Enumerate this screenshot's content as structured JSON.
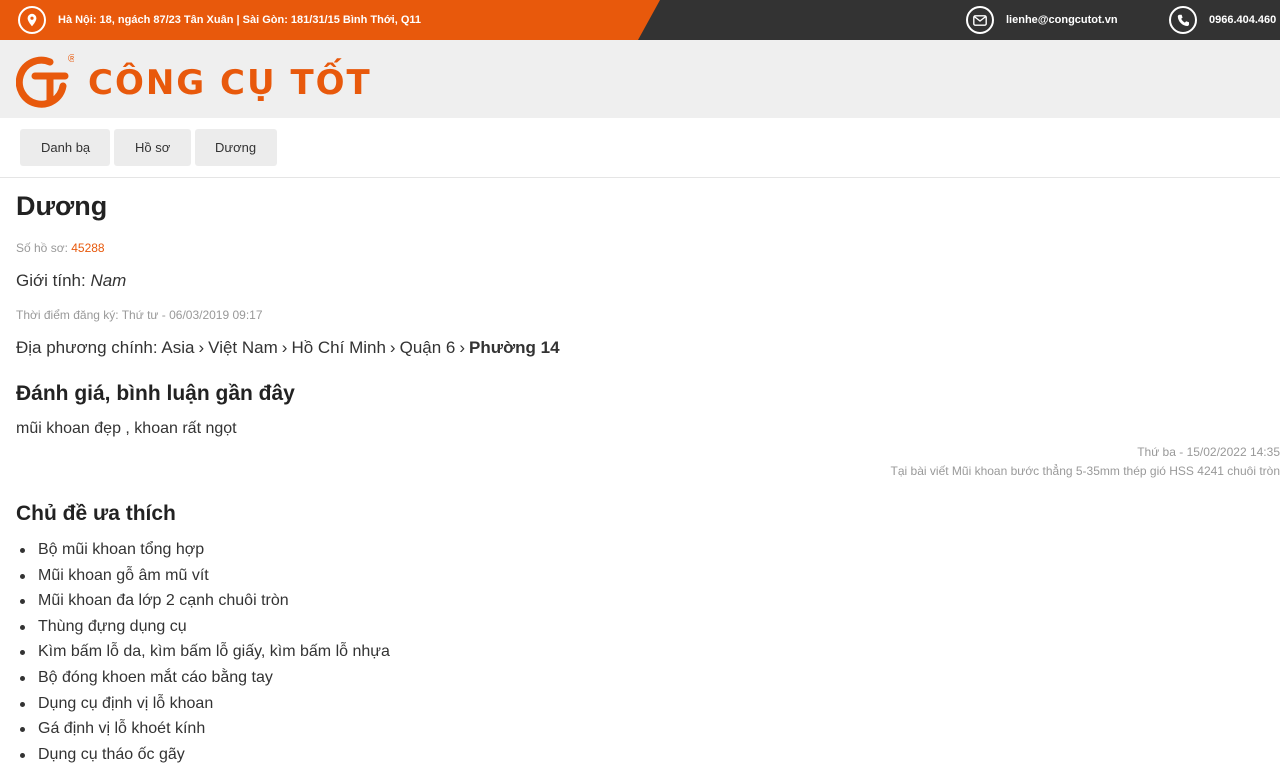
{
  "topbar": {
    "address": "Hà Nội: 18, ngách 87/23 Tân Xuân | Sài Gòn: 181/31/15 Bình Thới, Q11",
    "email": "lienhe@congcutot.vn",
    "phone": "0966.404.460",
    "icons": [
      "location-pin-icon",
      "envelope-icon",
      "phone-icon"
    ]
  },
  "logo": {
    "text": "CÔNG CỤ TỐT",
    "mark": "®"
  },
  "breadcrumb": [
    {
      "label": "Danh bạ"
    },
    {
      "label": "Hồ sơ"
    },
    {
      "label": "Dương"
    }
  ],
  "profile": {
    "name": "Dương",
    "profile_no_label": "Số hồ sơ: ",
    "profile_no": "45288",
    "gender_label": "Giới tính: ",
    "gender": "Nam",
    "registered": "Thời điểm đăng ký: Thứ tư - 06/03/2019 09:17",
    "location_label": "Địa phương chính: ",
    "location_path": [
      "Asia",
      "Việt Nam",
      "Hồ Chí Minh",
      "Quận 6"
    ],
    "location_current": "Phường 14"
  },
  "reviews": {
    "title": "Đánh giá, bình luận gần đây",
    "items": [
      {
        "text": "mũi khoan đẹp , khoan rất ngọt",
        "date": "Thứ ba - 15/02/2022 14:35",
        "post": "Tại bài viết Mũi khoan bước thẳng 5-35mm thép gió HSS 4241 chuôi tròn"
      }
    ]
  },
  "topics": {
    "title": "Chủ đề ưa thích",
    "items": [
      "Bộ mũi khoan tổng hợp",
      "Mũi khoan gỗ âm mũ vít",
      "Mũi khoan đa lớp 2 cạnh chuôi tròn",
      "Thùng đựng dụng cụ",
      "Kìm bấm lỗ da, kìm bấm lỗ giấy, kìm bấm lỗ nhựa",
      "Bộ đóng khoen mắt cáo bằng tay",
      "Dụng cụ định vị lỗ khoan",
      "Gá định vị lỗ khoét kính",
      "Dụng cụ tháo ốc gãy"
    ]
  },
  "colors": {
    "brand": "#e8590c",
    "topbar_dark": "#333333",
    "header_bg": "#efefef"
  }
}
